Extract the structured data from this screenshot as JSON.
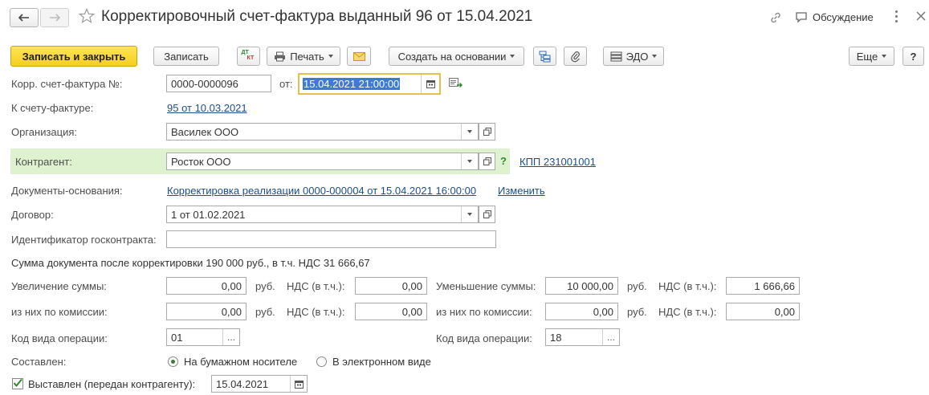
{
  "header": {
    "title": "Корректировочный счет-фактура выданный 96 от 15.04.2021",
    "discussion_label": "Обсуждение"
  },
  "toolbar": {
    "save_close_label": "Записать и закрыть",
    "save_label": "Записать",
    "dtkt_dt": "ДТ",
    "dtkt_kt": "КТ",
    "print_label": "Печать",
    "create_based_label": "Создать на основании",
    "edo_label": "ЭДО",
    "more_label": "Еще",
    "help_label": "?"
  },
  "form": {
    "corr_invoice_label": "Корр. счет-фактура №:",
    "corr_invoice_number": "0000-0000096",
    "date_from_label": "от:",
    "date_value": "15.04.2021 21:00:00",
    "to_invoice_label": "К счету-фактуре:",
    "to_invoice_link": "95 от 10.03.2021",
    "organization_label": "Организация:",
    "organization_value": "Василек ООО",
    "counterparty_label": "Контрагент:",
    "counterparty_value": "Росток ООО",
    "counterparty_help": "?",
    "kpp_link": "КПП 231001001",
    "base_docs_label": "Документы-основания:",
    "base_docs_link": "Корректировка реализации 0000-000004 от 15.04.2021 16:00:00",
    "change_link": "Изменить",
    "contract_label": "Договор:",
    "contract_value": "1 от 01.02.2021",
    "gov_contract_label": "Идентификатор госконтракта:",
    "gov_contract_value": "",
    "sum_after_text": "Сумма документа после корректировки 190 000 руб., в т.ч. НДС 31 666,67",
    "increase_label": "Увеличение суммы:",
    "increase_value": "0,00",
    "rub": "руб.",
    "vat_incl_label": "НДС (в т.ч.):",
    "increase_vat": "0,00",
    "decrease_label": "Уменьшение суммы:",
    "decrease_value": "10 000,00",
    "decrease_vat": "1 666,66",
    "commission_label": "из них по комиссии:",
    "inc_commission_value": "0,00",
    "inc_commission_vat": "0,00",
    "dec_commission_value": "0,00",
    "dec_commission_vat": "0,00",
    "op_code_label": "Код вида операции:",
    "op_code_left": "01",
    "op_code_right": "18",
    "dots": "...",
    "compiled_label": "Составлен:",
    "paper_option": "На бумажном носителе",
    "electronic_option": "В электронном виде",
    "paper_selected": true,
    "issued_label": "Выставлен (передан контрагенту):",
    "issued_checked": true,
    "issued_date": "15.04.2021"
  },
  "colors": {
    "primary_button": "#f5cf1a",
    "highlight_row": "#dff2cf",
    "link": "#1a4f8b",
    "active_border": "#e6c04a"
  }
}
